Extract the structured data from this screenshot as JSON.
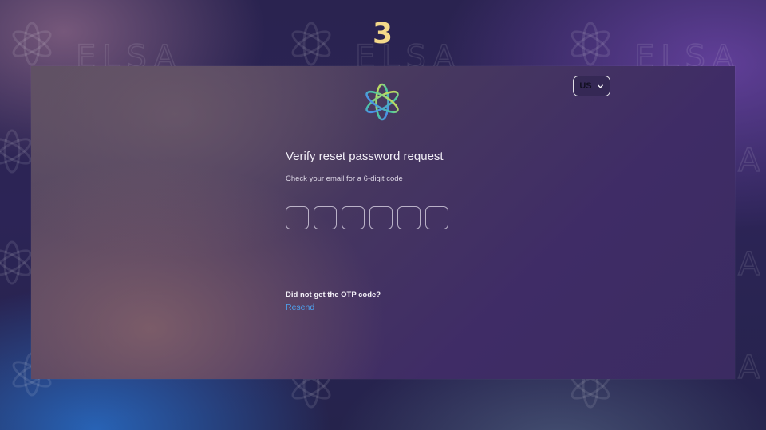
{
  "step": {
    "number": "3"
  },
  "brand": {
    "watermark_text": "ELSA",
    "logo_icon": "elsa-star-logo-icon"
  },
  "language": {
    "selected": "US",
    "icon": "chevron-down-icon"
  },
  "form": {
    "title": "Verify reset password request",
    "subtitle": "Check your email for a 6-digit code",
    "otp_values": [
      "",
      "",
      "",
      "",
      "",
      ""
    ]
  },
  "resend": {
    "question": "Did not get the OTP code?",
    "link_label": "Resend"
  },
  "colors": {
    "step_number": "#f4d98a",
    "link": "#4ea3f0",
    "title": "#f1eef6"
  }
}
